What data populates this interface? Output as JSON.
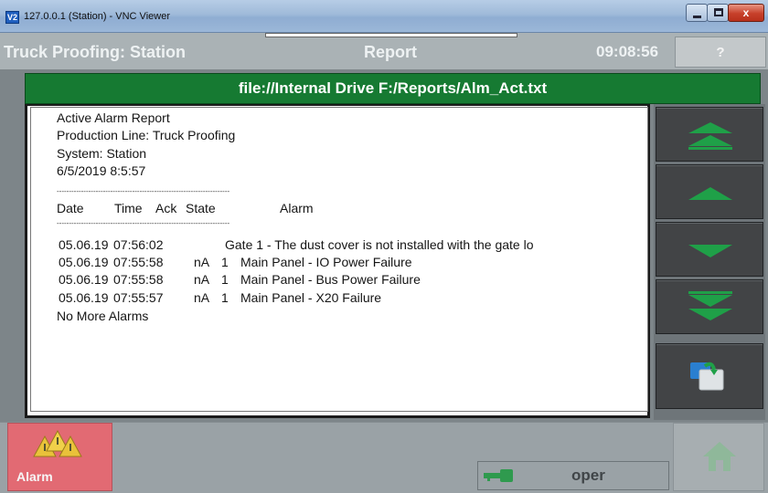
{
  "window": {
    "title": "127.0.0.1 (Station) - VNC Viewer",
    "icon_label": "V2",
    "min_icon": "minimize-icon",
    "max_icon": "maximize-icon",
    "close_label": "x"
  },
  "hmi": {
    "title": "Truck Proofing: Station",
    "section": "Report",
    "time": "09:08:56",
    "help_label": "?"
  },
  "file_path": "file://Internal Drive F:/Reports/Alm_Act.txt",
  "report": {
    "header_lines": [
      "Active Alarm Report",
      "Production Line: Truck Proofing",
      "System: Station",
      "6/5/2019 8:5:57"
    ],
    "divider": "-----------------------------------------------------------------------",
    "columns": {
      "date": "Date",
      "time": "Time",
      "ack": "Ack",
      "state": "State",
      "alarm": "Alarm"
    },
    "rows": [
      {
        "date": "05.06.19",
        "time": "07:56:02",
        "ack": "",
        "state": "",
        "alarm": "Gate 1 - The dust cover is not installed with the gate lo"
      },
      {
        "date": "05.06.19",
        "time": "07:55:58",
        "ack": "nA",
        "state": "1",
        "alarm": "Main Panel - IO Power Failure"
      },
      {
        "date": "05.06.19",
        "time": "07:55:58",
        "ack": "nA",
        "state": "1",
        "alarm": "Main Panel - Bus Power Failure"
      },
      {
        "date": "05.06.19",
        "time": "07:55:57",
        "ack": "nA",
        "state": "1",
        "alarm": "Main Panel - X20 Failure"
      }
    ],
    "footer": "No More Alarms"
  },
  "nav_buttons": [
    {
      "icon": "page-up-double-icon"
    },
    {
      "icon": "scroll-up-icon"
    },
    {
      "icon": "scroll-down-icon"
    },
    {
      "icon": "page-down-double-icon"
    },
    {
      "icon": "window-switch-icon"
    }
  ],
  "bottom": {
    "alarm_label": "Alarm",
    "status_text": "oper",
    "key_icon": "key-icon",
    "home_icon": "home-icon"
  },
  "colors": {
    "file_bar": "#167a32",
    "arrow_green": "#1fa048",
    "alarm_button": "#e26a73",
    "nav_button": "#424446"
  }
}
